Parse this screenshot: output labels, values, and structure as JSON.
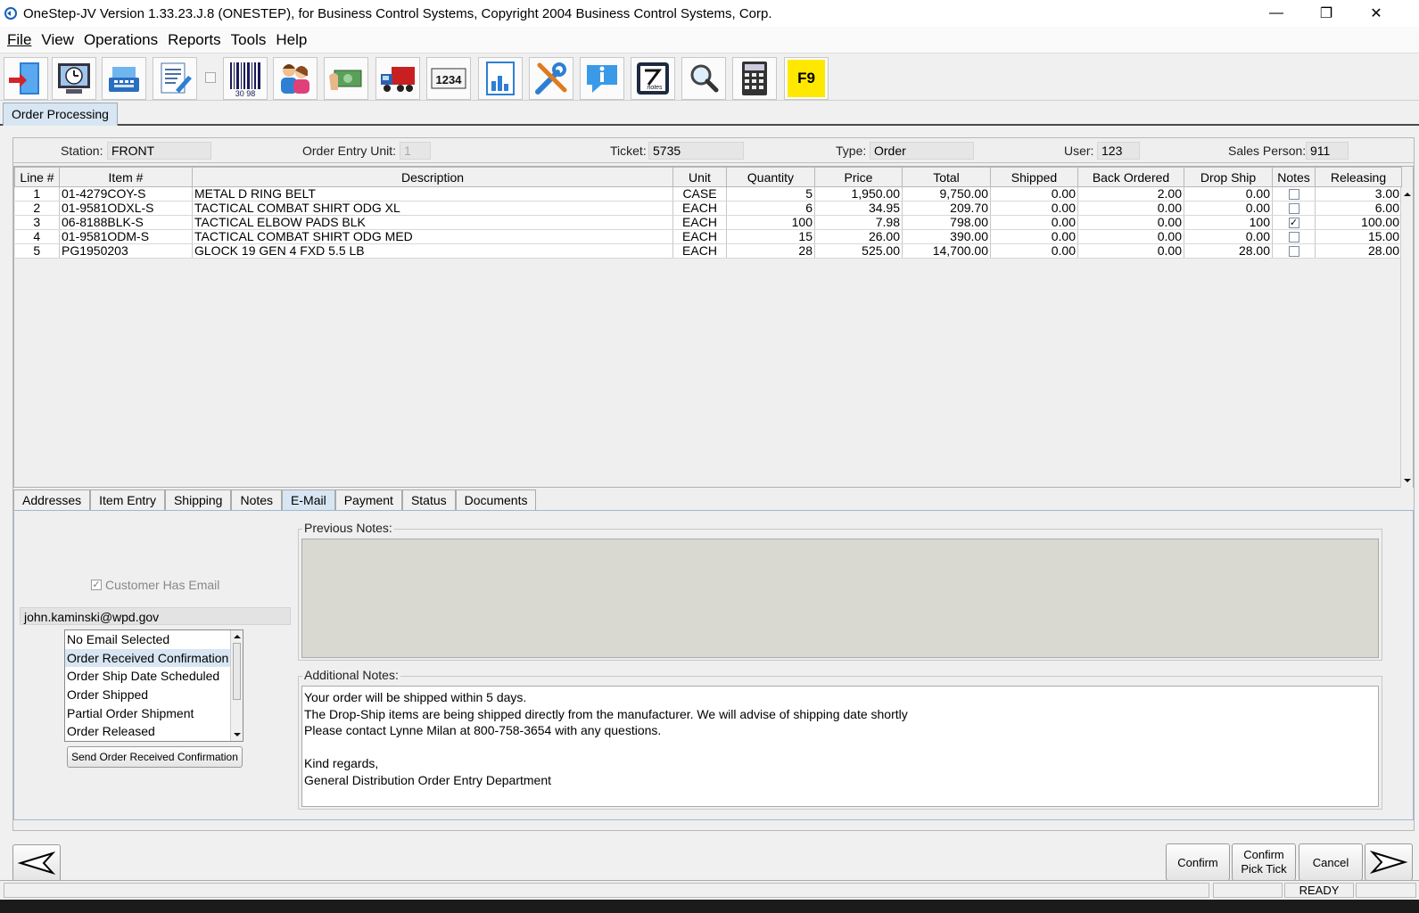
{
  "window": {
    "title": "OneStep-JV Version 1.33.23.J.8 (ONESTEP), for Business Control Systems, Copyright  2004 Business Control Systems, Corp.",
    "minimize": "—",
    "restore": "❐",
    "close": "✕"
  },
  "menu": [
    "File",
    "View",
    "Operations",
    "Reports",
    "Tools",
    "Help"
  ],
  "toolbar": {
    "icons": [
      "exit-icon",
      "clock-icon",
      "cash-register-icon",
      "document-edit-icon",
      "barcode-icon",
      "customers-icon",
      "money-icon",
      "truck-icon",
      "counter-icon",
      "report-chart-icon",
      "tools-icon",
      "info-icon",
      "notes-icon",
      "magnifier-icon",
      "calculator-icon",
      "f9-icon"
    ],
    "barcode_text": "30 98",
    "counter_text": "1234",
    "notes_text": "notes",
    "f9_label": "F9"
  },
  "main_tab": "Order Processing",
  "header": {
    "station_label": "Station:",
    "station_value": "FRONT",
    "unit_label": "Order Entry Unit:",
    "unit_value": "1",
    "ticket_label": "Ticket:",
    "ticket_value": "5735",
    "type_label": "Type:",
    "type_value": "Order",
    "user_label": "User:",
    "user_value": "123",
    "salesperson_label": "Sales Person:",
    "salesperson_value": "911"
  },
  "grid": {
    "columns": [
      "Line #",
      "Item #",
      "Description",
      "Unit",
      "Quantity",
      "Price",
      "Total",
      "Shipped",
      "Back Ordered",
      "Drop Ship",
      "Notes",
      "Releasing"
    ],
    "rows": [
      [
        "1",
        "01-4279COY-S",
        "METAL D RING BELT",
        "CASE",
        "5",
        "1,950.00",
        "9,750.00",
        "0.00",
        "2.00",
        "0.00",
        false,
        "3.00"
      ],
      [
        "2",
        "01-9581ODXL-S",
        "TACTICAL COMBAT SHIRT ODG XL",
        "EACH",
        "6",
        "34.95",
        "209.70",
        "0.00",
        "0.00",
        "0.00",
        false,
        "6.00"
      ],
      [
        "3",
        "06-8188BLK-S",
        "TACTICAL ELBOW PADS BLK",
        "EACH",
        "100",
        "7.98",
        "798.00",
        "0.00",
        "0.00",
        "100",
        true,
        "100.00"
      ],
      [
        "4",
        "01-9581ODM-S",
        "TACTICAL COMBAT SHIRT ODG MED",
        "EACH",
        "15",
        "26.00",
        "390.00",
        "0.00",
        "0.00",
        "0.00",
        false,
        "15.00"
      ],
      [
        "5",
        "PG1950203",
        "GLOCK 19 GEN 4 FXD 5.5 LB",
        "EACH",
        "28",
        "525.00",
        "14,700.00",
        "0.00",
        "0.00",
        "28.00",
        false,
        "28.00"
      ]
    ]
  },
  "subtabs": [
    "Addresses",
    "Item Entry",
    "Shipping",
    "Notes",
    "E-Mail",
    "Payment",
    "Status",
    "Documents"
  ],
  "email": {
    "customer_has_email": "Customer Has Email",
    "address": "john.kaminski@wpd.gov",
    "options": [
      "No Email Selected",
      "Order Received Confirmation",
      "Order Ship Date Scheduled",
      "Order Shipped",
      "Partial Order Shipment",
      "Order Released"
    ],
    "selected": "Order Received Confirmation",
    "send_button": "Send Order Received Confirmation",
    "previous_notes_label": "Previous Notes:",
    "additional_notes_label": "Additional Notes:",
    "additional_notes": [
      "Your order will be shipped within 5 days.",
      "The Drop-Ship items are being shipped directly from the manufacturer. We will advise of shipping date shortly",
      "Please contact Lynne Milan at 800-758-3654 with any questions.",
      "",
      "Kind regards,",
      "General Distribution Order Entry Department"
    ]
  },
  "buttons": {
    "confirm": "Confirm",
    "confirm_pick_1": "Confirm",
    "confirm_pick_2": "Pick Tick",
    "cancel": "Cancel"
  },
  "status": "READY"
}
